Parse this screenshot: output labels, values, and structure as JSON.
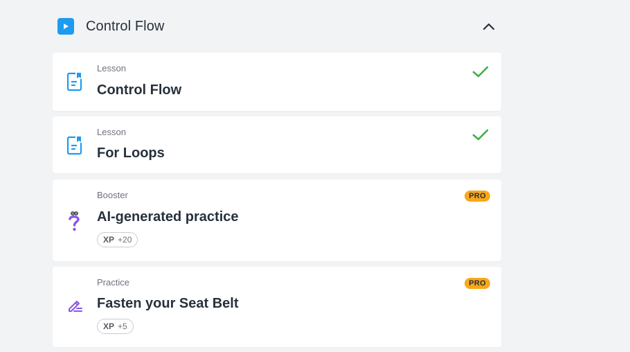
{
  "section": {
    "title": "Control Flow",
    "icon": "play-icon",
    "collapse_icon": "chevron-up-icon",
    "accent": "#1d9bf0"
  },
  "cards": [
    {
      "kind": "Lesson",
      "title": "Control Flow",
      "icon": "lesson-doc-icon",
      "status": "completed"
    },
    {
      "kind": "Lesson",
      "title": "For Loops",
      "icon": "lesson-doc-icon",
      "status": "completed"
    },
    {
      "kind": "Booster",
      "title": "AI-generated practice",
      "icon": "question-mark-icon",
      "badge": "PRO",
      "xp_label": "XP",
      "xp_value": "+20"
    },
    {
      "kind": "Practice",
      "title": "Fasten your Seat Belt",
      "icon": "pencil-lines-icon",
      "badge": "PRO",
      "xp_label": "XP",
      "xp_value": "+5"
    }
  ],
  "colors": {
    "check": "#3cb043",
    "pro_badge": "#f7a81b",
    "lesson_icon": "#1d9bf0",
    "practice_icon": "#8a56e8"
  }
}
